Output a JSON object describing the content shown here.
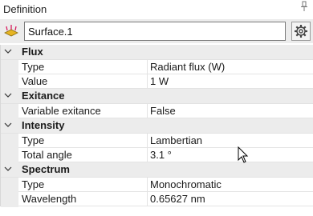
{
  "panel": {
    "title": "Definition",
    "pin_icon": "pin-icon",
    "object_icon": "surface-source-icon",
    "name_value": "Surface.1",
    "settings_icon": "gear-icon"
  },
  "colors": {
    "header_bg": "#ececec",
    "row_bg": "#ffffff",
    "grid_line": "#e3e3e3",
    "icon_gold": "#e6b422"
  },
  "sections": [
    {
      "label": "Flux",
      "rows": [
        {
          "key": "Type",
          "value": "Radiant flux (W)"
        },
        {
          "key": "Value",
          "value": "1 W"
        }
      ]
    },
    {
      "label": "Exitance",
      "rows": [
        {
          "key": "Variable exitance",
          "value": "False"
        }
      ]
    },
    {
      "label": "Intensity",
      "rows": [
        {
          "key": "Type",
          "value": "Lambertian"
        },
        {
          "key": "Total angle",
          "value": "3.1 °"
        }
      ]
    },
    {
      "label": "Spectrum",
      "rows": [
        {
          "key": "Type",
          "value": "Monochromatic"
        },
        {
          "key": "Wavelength",
          "value": "0.65627 nm"
        }
      ]
    }
  ]
}
